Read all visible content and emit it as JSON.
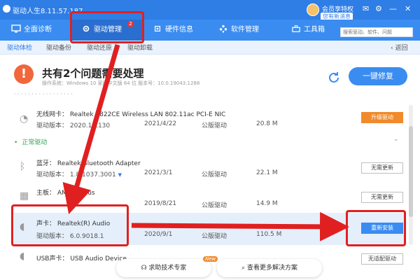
{
  "window": {
    "title": "驱动人生8.11.57.187",
    "user_name": "会员享特权",
    "message_badge": "您有新消息"
  },
  "nav": {
    "items": [
      {
        "label": "全面诊断"
      },
      {
        "label": "驱动管理",
        "badge": "2"
      },
      {
        "label": "硬件信息"
      },
      {
        "label": "软件管理"
      },
      {
        "label": "工具箱"
      }
    ],
    "search_placeholder": "搜索驱动、软件、问题"
  },
  "subtabs": {
    "items": [
      "驱动体检",
      "驱动备份",
      "驱动还原",
      "驱动卸载"
    ],
    "back": "返回"
  },
  "summary": {
    "title": "共有2个问题需要处理",
    "sys_info": "操作系统：Windows 10 家庭中文版 64 位    版本号：10.0.19043.1288",
    "fix_button": "一键修复"
  },
  "rows": [
    {
      "name": "无线网卡：  Realtek 8822CE Wireless LAN 802.11ac PCI-E NIC",
      "version": "驱动版本：  2020.10.130",
      "date": "2021/4/22",
      "type": "公版驱动",
      "size": "20.8 M",
      "action": "升级驱动"
    },
    {
      "name": "蓝牙：  Realtek Bluetooth Adapter",
      "version": "驱动版本：  1.8.1037.3001",
      "date": "2021/3/1",
      "type": "公版驱动",
      "size": "22.1 M",
      "action": "无需更新"
    },
    {
      "name": "主板：  AMD SMBus",
      "version": "",
      "date": "2019/8/21",
      "type": "公版驱动",
      "size": "14.9 M",
      "action": "无需更新"
    },
    {
      "name": "声卡：  Realtek(R) Audio",
      "version": "驱动版本：  6.0.9018.1",
      "date": "2020/9/1",
      "type": "公版驱动",
      "size": "110.5 M",
      "action": "重新安装"
    },
    {
      "name": "USB声卡：  USB Audio Device",
      "version": "",
      "date": "",
      "type": "",
      "size": "",
      "action": "无适配驱动"
    }
  ],
  "section_normal": "正常驱动",
  "bottom": {
    "help_button": "求助技术专家",
    "help_tag": "New",
    "more_button": "查看更多解决方案"
  },
  "colors": {
    "primary": "#3a8cf0",
    "alert": "#f0673b",
    "callout": "#e02020",
    "upgrade": "#f08a2b"
  }
}
